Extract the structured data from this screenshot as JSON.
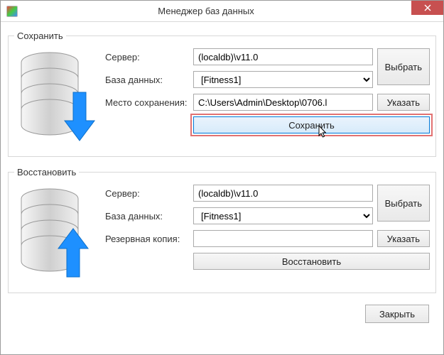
{
  "window": {
    "title": "Менеджер баз данных"
  },
  "save": {
    "legend": "Сохранить",
    "server_label": "Сервер:",
    "server_value": "(localdb)\\v11.0",
    "choose_server_btn": "Выбрать",
    "db_label": "База данных:",
    "db_value": "[Fitness1]",
    "path_label": "Место сохранения:",
    "path_value": "C:\\Users\\Admin\\Desktop\\0706.l",
    "path_btn": "Указать",
    "action_btn": "Сохранить"
  },
  "restore": {
    "legend": "Восстановить",
    "server_label": "Сервер:",
    "server_value": "(localdb)\\v11.0",
    "choose_server_btn": "Выбрать",
    "db_label": "База данных:",
    "db_value": "[Fitness1]",
    "backup_label": "Резервная копия:",
    "backup_value": "",
    "backup_btn": "Указать",
    "action_btn": "Восстановить"
  },
  "footer": {
    "close_btn": "Закрыть"
  }
}
